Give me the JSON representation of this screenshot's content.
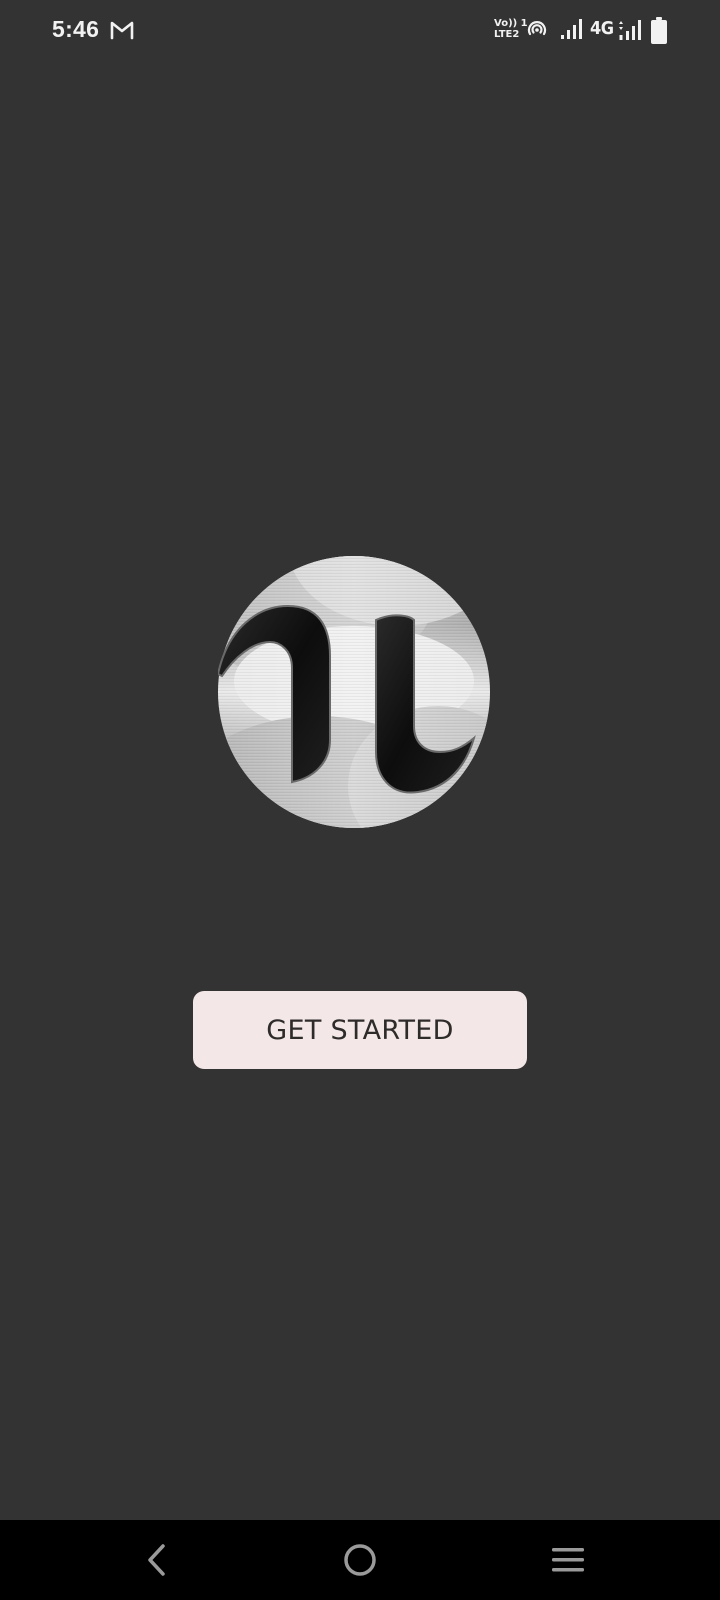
{
  "status_bar": {
    "time": "5:46",
    "notification_icons": [
      "gmail-icon"
    ],
    "volte_line1": "Vo)) 1",
    "volte_line2": "LTE2",
    "network_type": "4G",
    "icons": [
      "hotspot-icon",
      "signal-icon",
      "signal-icon",
      "battery-icon"
    ]
  },
  "logo": {
    "icon": "app-logo"
  },
  "main": {
    "get_started_label": "GET STARTED"
  },
  "colors": {
    "background": "#333333",
    "button_bg": "#f4e7e7",
    "button_text": "#2e2b2b",
    "nav_bar": "#000000"
  },
  "nav_bar": {
    "icons": [
      "back-icon",
      "home-icon",
      "menu-icon"
    ]
  }
}
